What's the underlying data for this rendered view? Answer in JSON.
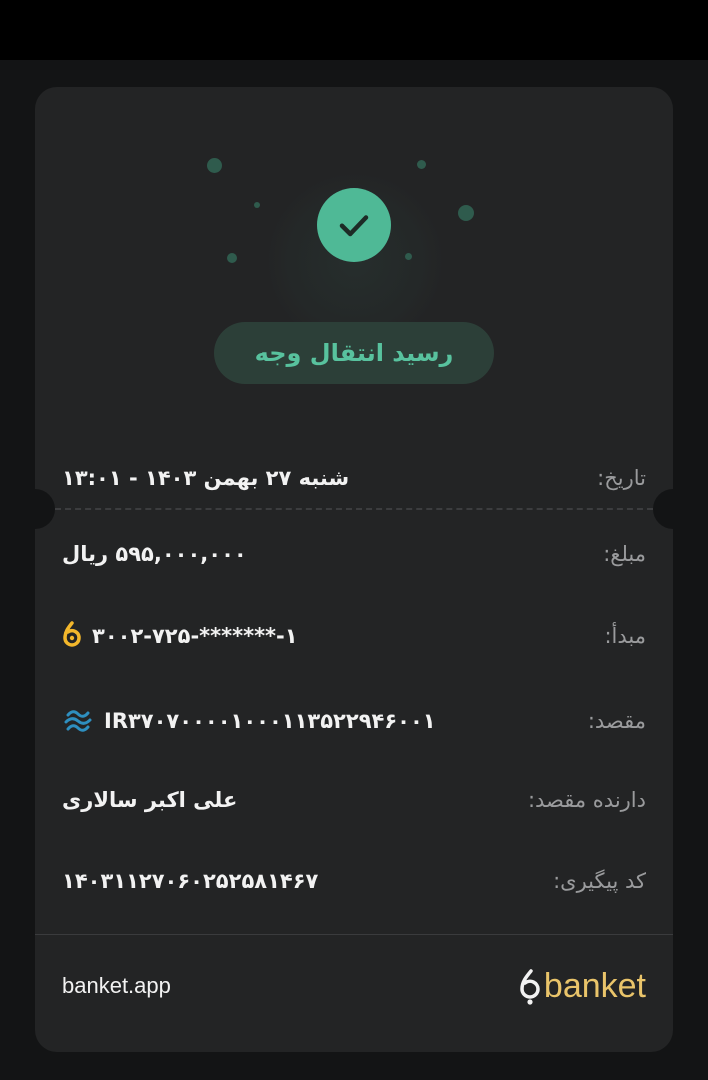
{
  "receipt": {
    "title": "رسید انتقال وجه",
    "colors": {
      "accent": "#4fb996",
      "background": "#131415",
      "card": "#232425",
      "brand": "#f3c65a"
    },
    "rows": [
      {
        "label": "تاریخ:",
        "value": "شنبه ۲۷ بهمن ۱۴۰۳ - ۱۳:۰۱"
      },
      {
        "label": "مبلغ:",
        "value": "۵۹۵,۰۰۰,۰۰۰ ریال"
      },
      {
        "label": "مبدأ:",
        "value": "۳۰۰۲-۷۲۵-*******-۱",
        "icon": "banket-coin-icon"
      },
      {
        "label": "مقصد:",
        "value": "IR۳۷۰۷۰۰۰۰۱۰۰۰۱۱۳۵۲۲۹۴۶۰۰۱",
        "icon": "bank-logo-icon"
      },
      {
        "label": "دارنده مقصد:",
        "value": "علی اکبر سالاری"
      },
      {
        "label": "کد پیگیری:",
        "value": "۱۴۰۳۱۱۲۷۰۶۰۲۵۲۵۸۱۴۶۷"
      }
    ]
  },
  "footer": {
    "link": "banket.app",
    "brand": "banket"
  }
}
